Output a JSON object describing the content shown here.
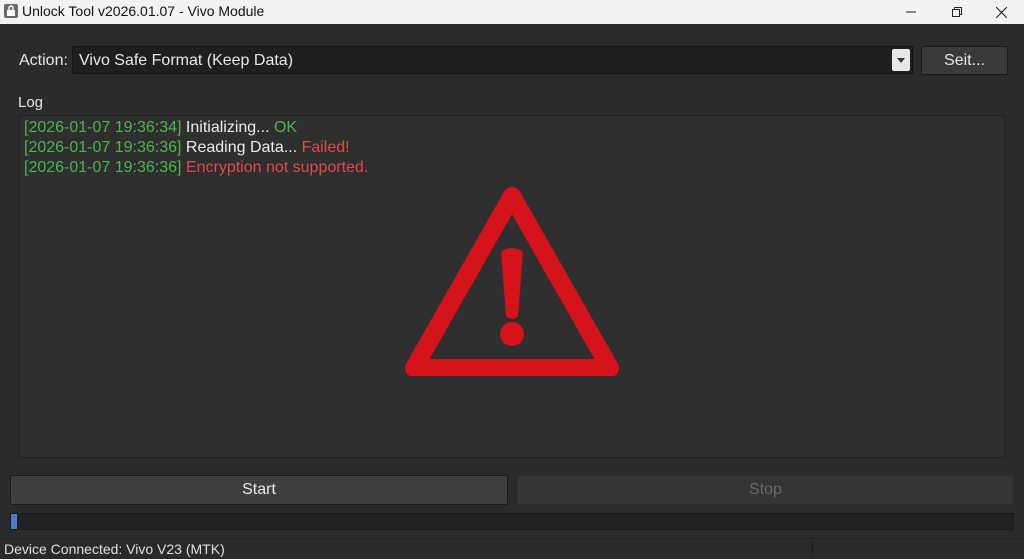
{
  "window": {
    "title": "Unlock Tool v2026.01.07 - Vivo Module",
    "icons": {
      "app": "lock-icon",
      "minimize": "minimize-icon",
      "maximize": "restore-icon",
      "close": "close-icon"
    }
  },
  "action": {
    "label": "Action:",
    "selected": "Vivo Safe Format (Keep Data)",
    "settings_label": "Seit..."
  },
  "log": {
    "label": "Log",
    "lines": [
      {
        "timestamp": "[2026-01-07 19:36:34]",
        "message": "Initializing...",
        "result": "OK",
        "result_status": "ok"
      },
      {
        "timestamp": "[2026-01-07 19:36:36]",
        "message": "Reading Data...",
        "result": "Failed!",
        "result_status": "error"
      },
      {
        "timestamp": "[2026-01-07 19:36:36]",
        "message": "",
        "result": "Encryption not supported.",
        "result_status": "error"
      }
    ],
    "overlay_icon": "warning-triangle-icon"
  },
  "controls": {
    "start_label": "Start",
    "stop_label": "Stop"
  },
  "progress": {
    "percent": 0.6
  },
  "status": {
    "text": "Device Connected: Vivo V23 (MTK)"
  },
  "colors": {
    "ok": "#49b84a",
    "error": "#e24a4a",
    "warning": "#d4141a",
    "progress": "#4a7bd0"
  }
}
